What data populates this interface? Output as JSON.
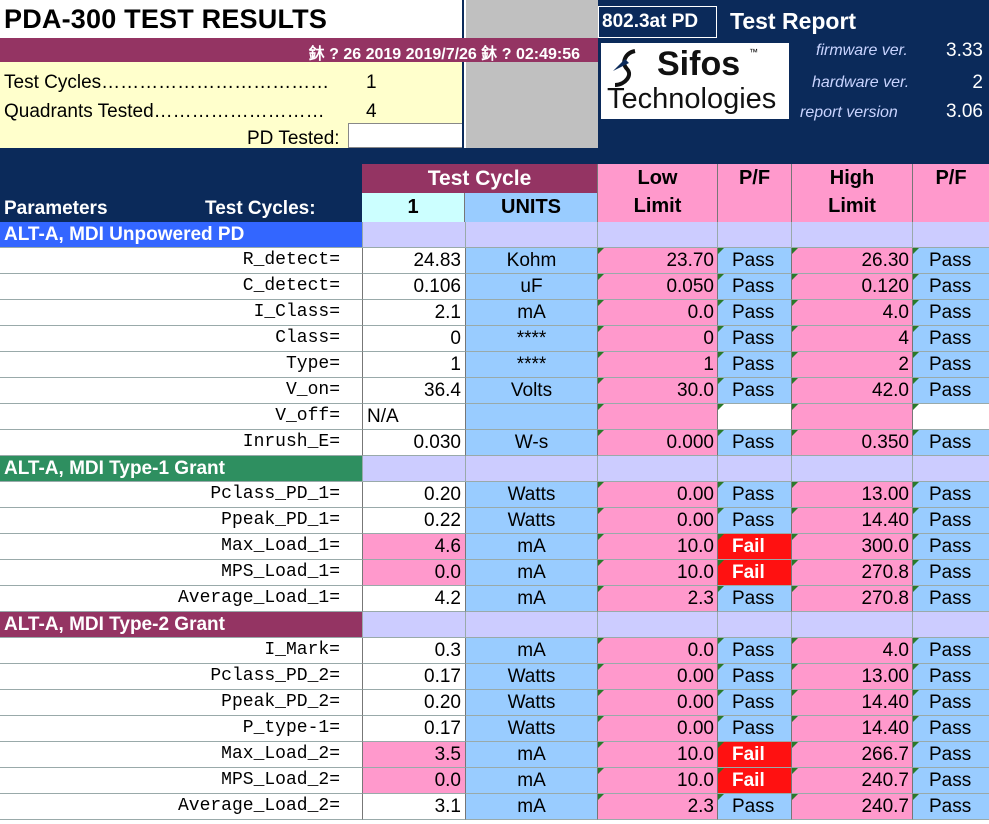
{
  "colors": {
    "navy": "#0b2a5a",
    "maroon": "#943463",
    "blue_section": "#3366ff",
    "green_section": "#2e8f60",
    "lavender": "#ccccff",
    "light_blue": "#99ccff",
    "pink": "#ff99cc",
    "cyan": "#ccffff",
    "cream": "#ffffcc",
    "fail_red": "#ff1111"
  },
  "title": "PDA-300 TEST RESULTS",
  "date_bar": "鈢   ? 26 2019  2019/7/26 鈢     ? 02:49:56",
  "test_cycles_label": "Test Cycles………………………………",
  "test_cycles_value": "1",
  "quadrants_label": "Quadrants Tested………………………",
  "quadrants_value": "4",
  "pd_tested_label": "PD Tested:",
  "pd_tested_value": "",
  "pd_type": "802.3at PD",
  "report_title": "Test Report",
  "logo": {
    "line1": "Sifos",
    "tm": "™",
    "line2": "Technologies"
  },
  "info": [
    {
      "label": "firmware ver.",
      "value": "3.33"
    },
    {
      "label": "hardware ver.",
      "value": "2"
    },
    {
      "label": "report version",
      "value": "3.06"
    }
  ],
  "header": {
    "parameters": "Parameters",
    "test_cycles": "Test Cycles:",
    "test_cycle": "Test Cycle",
    "cycle_num": "1",
    "units": "UNITS",
    "low": "Low",
    "high": "High",
    "limit": "Limit",
    "pf": "P/F"
  },
  "sections": [
    {
      "title": "ALT-A, MDI Unpowered PD",
      "color": "#3366ff",
      "rows": [
        {
          "param": "R_detect=",
          "value": "24.83",
          "unit": "Kohm",
          "low": "23.70",
          "low_pf": "Pass",
          "high": "26.30",
          "high_pf": "Pass"
        },
        {
          "param": "C_detect=",
          "value": "0.106",
          "unit": "uF",
          "low": "0.050",
          "low_pf": "Pass",
          "high": "0.120",
          "high_pf": "Pass"
        },
        {
          "param": "I_Class=",
          "value": "2.1",
          "unit": "mA",
          "low": "0.0",
          "low_pf": "Pass",
          "high": "4.0",
          "high_pf": "Pass"
        },
        {
          "param": "Class=",
          "value": "0",
          "unit": "****",
          "low": "0",
          "low_pf": "Pass",
          "high": "4",
          "high_pf": "Pass"
        },
        {
          "param": "Type=",
          "value": "1",
          "unit": "****",
          "low": "1",
          "low_pf": "Pass",
          "high": "2",
          "high_pf": "Pass"
        },
        {
          "param": "V_on=",
          "value": "36.4",
          "unit": "Volts",
          "low": "30.0",
          "low_pf": "Pass",
          "high": "42.0",
          "high_pf": "Pass"
        },
        {
          "param": "V_off=",
          "value": "N/A",
          "unit": "",
          "low": "",
          "low_pf": "",
          "high": "",
          "high_pf": "",
          "na": true
        },
        {
          "param": "Inrush_E=",
          "value": "0.030",
          "unit": "W-s",
          "low": "0.000",
          "low_pf": "Pass",
          "high": "0.350",
          "high_pf": "Pass"
        }
      ]
    },
    {
      "title": "ALT-A, MDI Type-1 Grant",
      "color": "#2e8f60",
      "rows": [
        {
          "param": "Pclass_PD_1=",
          "value": "0.20",
          "unit": "Watts",
          "low": "0.00",
          "low_pf": "Pass",
          "high": "13.00",
          "high_pf": "Pass"
        },
        {
          "param": "Ppeak_PD_1=",
          "value": "0.22",
          "unit": "Watts",
          "low": "0.00",
          "low_pf": "Pass",
          "high": "14.40",
          "high_pf": "Pass"
        },
        {
          "param": "Max_Load_1=",
          "value": "4.6",
          "unit": "mA",
          "low": "10.0",
          "low_pf": "Fail",
          "high": "300.0",
          "high_pf": "Pass",
          "fail": true
        },
        {
          "param": "MPS_Load_1=",
          "value": "0.0",
          "unit": "mA",
          "low": "10.0",
          "low_pf": "Fail",
          "high": "270.8",
          "high_pf": "Pass",
          "fail": true
        },
        {
          "param": "Average_Load_1=",
          "value": "4.2",
          "unit": "mA",
          "low": "2.3",
          "low_pf": "Pass",
          "high": "270.8",
          "high_pf": "Pass"
        }
      ]
    },
    {
      "title": "ALT-A, MDI Type-2 Grant",
      "color": "#943463",
      "rows": [
        {
          "param": "I_Mark=",
          "value": "0.3",
          "unit": "mA",
          "low": "0.0",
          "low_pf": "Pass",
          "high": "4.0",
          "high_pf": "Pass"
        },
        {
          "param": "Pclass_PD_2=",
          "value": "0.17",
          "unit": "Watts",
          "low": "0.00",
          "low_pf": "Pass",
          "high": "13.00",
          "high_pf": "Pass"
        },
        {
          "param": "Ppeak_PD_2=",
          "value": "0.20",
          "unit": "Watts",
          "low": "0.00",
          "low_pf": "Pass",
          "high": "14.40",
          "high_pf": "Pass"
        },
        {
          "param": "P_type-1=",
          "value": "0.17",
          "unit": "Watts",
          "low": "0.00",
          "low_pf": "Pass",
          "high": "14.40",
          "high_pf": "Pass"
        },
        {
          "param": "Max_Load_2=",
          "value": "3.5",
          "unit": "mA",
          "low": "10.0",
          "low_pf": "Fail",
          "high": "266.7",
          "high_pf": "Pass",
          "fail": true
        },
        {
          "param": "MPS_Load_2=",
          "value": "0.0",
          "unit": "mA",
          "low": "10.0",
          "low_pf": "Fail",
          "high": "240.7",
          "high_pf": "Pass",
          "fail": true
        },
        {
          "param": "Average_Load_2=",
          "value": "3.1",
          "unit": "mA",
          "low": "2.3",
          "low_pf": "Pass",
          "high": "240.7",
          "high_pf": "Pass"
        }
      ]
    }
  ]
}
